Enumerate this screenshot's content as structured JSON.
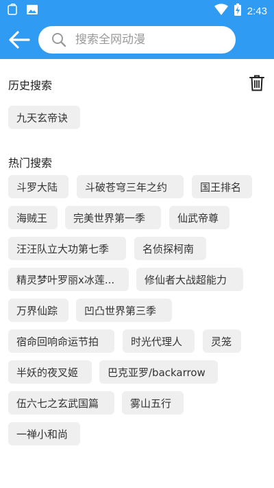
{
  "status_bar": {
    "time": "2:43",
    "icons": [
      "app-notification-icon",
      "image-icon",
      "wifi-icon",
      "battery-charging-icon"
    ]
  },
  "header": {
    "back_icon": "arrow-left-icon",
    "search_placeholder": "搜索全网动漫",
    "search_value": ""
  },
  "history": {
    "title": "历史搜索",
    "clear_icon": "trash-icon",
    "items": [
      "九天玄帝诀"
    ]
  },
  "hot": {
    "title": "热门搜索",
    "items": [
      "斗罗大陆",
      "斗破苍穹三年之约",
      "国王排名",
      "海贼王",
      "完美世界第一季",
      "仙武帝尊",
      "汪汪队立大功第七季",
      "名侦探柯南",
      "精灵梦叶罗丽x冰莲...",
      "修仙者大战超能力",
      "万界仙踪",
      "凹凸世界第三季",
      "宿命回响命运节拍",
      "时光代理人",
      "灵笼",
      "半妖的夜叉姬",
      "巴克亚罗/backarrow",
      "伍六七之玄武国篇",
      "雾山五行",
      "一禅小和尚"
    ]
  },
  "colors": {
    "primary": "#2f9bf2",
    "chip_bg": "#efefef"
  }
}
